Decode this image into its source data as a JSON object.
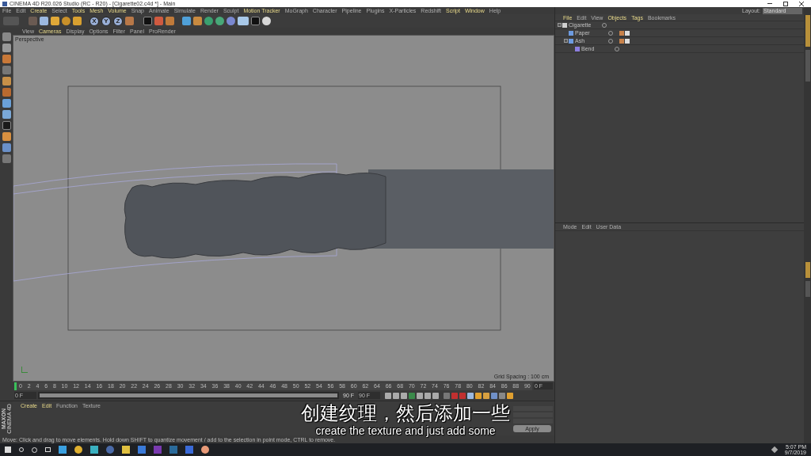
{
  "window": {
    "title": "CINEMA 4D R20.026 Studio (RC - R20) - [Cigarette02.c4d *] - Main"
  },
  "menu": [
    {
      "label": "File",
      "highlighted": false
    },
    {
      "label": "Edit",
      "highlighted": false
    },
    {
      "label": "Create",
      "highlighted": true
    },
    {
      "label": "Select",
      "highlighted": false
    },
    {
      "label": "Tools",
      "highlighted": true
    },
    {
      "label": "Mesh",
      "highlighted": true
    },
    {
      "label": "Volume",
      "highlighted": true
    },
    {
      "label": "Snap",
      "highlighted": false
    },
    {
      "label": "Animate",
      "highlighted": false
    },
    {
      "label": "Simulate",
      "highlighted": false
    },
    {
      "label": "Render",
      "highlighted": false
    },
    {
      "label": "Sculpt",
      "highlighted": false
    },
    {
      "label": "Motion Tracker",
      "highlighted": true
    },
    {
      "label": "MoGraph",
      "highlighted": false
    },
    {
      "label": "Character",
      "highlighted": false
    },
    {
      "label": "Pipeline",
      "highlighted": false
    },
    {
      "label": "Plugins",
      "highlighted": false
    },
    {
      "label": "X-Particles",
      "highlighted": false
    },
    {
      "label": "Redshift",
      "highlighted": false
    },
    {
      "label": "Script",
      "highlighted": true
    },
    {
      "label": "Window",
      "highlighted": true
    },
    {
      "label": "Help",
      "highlighted": false
    }
  ],
  "axis_buttons": [
    "X",
    "Y",
    "Z"
  ],
  "viewport": {
    "menu": [
      {
        "label": "View",
        "highlighted": false
      },
      {
        "label": "Cameras",
        "highlighted": true
      },
      {
        "label": "Display",
        "highlighted": false
      },
      {
        "label": "Options",
        "highlighted": false
      },
      {
        "label": "Filter",
        "highlighted": false
      },
      {
        "label": "Panel",
        "highlighted": false
      },
      {
        "label": "ProRender",
        "highlighted": false
      }
    ],
    "camera": "Perspective",
    "grid_spacing": "Grid Spacing : 100 cm"
  },
  "timeline": {
    "ticks": [
      "0",
      "2",
      "4",
      "6",
      "8",
      "10",
      "12",
      "14",
      "16",
      "18",
      "20",
      "22",
      "24",
      "26",
      "28",
      "30",
      "32",
      "34",
      "36",
      "38",
      "40",
      "42",
      "44",
      "46",
      "48",
      "50",
      "52",
      "54",
      "56",
      "58",
      "60",
      "62",
      "64",
      "66",
      "68",
      "70",
      "72",
      "74",
      "76",
      "78",
      "80",
      "82",
      "84",
      "86",
      "88",
      "90"
    ],
    "current_frame": "0 F",
    "start": "0 F",
    "range": {
      "label": "90 F",
      "level": 1
    },
    "end": "90 F",
    "level": 0
  },
  "material_manager": {
    "menu": [
      {
        "label": "Create",
        "highlighted": true
      },
      {
        "label": "Edit",
        "highlighted": true
      },
      {
        "label": "Function",
        "highlighted": false
      },
      {
        "label": "Texture",
        "highlighted": false
      }
    ],
    "apply": "Apply"
  },
  "logo": {
    "brand": "MAXON",
    "product": "CINEMA 4D"
  },
  "status_bar": "Move: Click and drag to move elements. Hold down SHIFT to quantize movement / add to the selection in point mode, CTRL to remove.",
  "layout": {
    "label": "Layout:",
    "value": "Standard"
  },
  "object_manager": {
    "menu": [
      {
        "label": "File",
        "highlighted": true
      },
      {
        "label": "Edit",
        "highlighted": false
      },
      {
        "label": "View",
        "highlighted": false
      },
      {
        "label": "Objects",
        "highlighted": true
      },
      {
        "label": "Tags",
        "highlighted": true
      },
      {
        "label": "Bookmarks",
        "highlighted": false
      }
    ],
    "objects": [
      {
        "name": "Cigarette",
        "kind": "null",
        "expanded": true,
        "children": [
          {
            "name": "Paper",
            "kind": "mesh"
          },
          {
            "name": "Ash",
            "kind": "mesh",
            "expanded": true,
            "children": [
              {
                "name": "Bend",
                "kind": "deformer"
              }
            ]
          }
        ]
      }
    ]
  },
  "attributes": {
    "menu": [
      "Mode",
      "Edit",
      "User Data"
    ]
  },
  "subtitles": {
    "chinese": "创建纹理，然后添加一些",
    "english": "create the texture and just add some"
  },
  "taskbar": {
    "time": "5:07 PM",
    "date": "9/7/2019"
  }
}
